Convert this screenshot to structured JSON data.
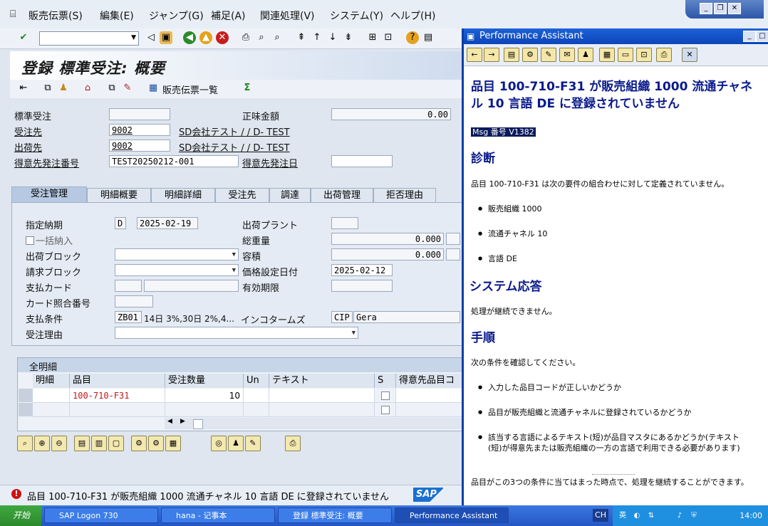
{
  "menu": [
    "販売伝票(S)",
    "編集(E)",
    "ジャンプ(G)",
    "補足(A)",
    "関連処理(V)",
    "システム(Y)",
    "ヘルプ(H)"
  ],
  "screen_title": "登録 標準受注: 概要",
  "toolbar2": {
    "list_label": "販売伝票一覧"
  },
  "header_fields": {
    "order_type_label": "標準受注",
    "net_value_label": "正味金額",
    "net_value": "0.00",
    "sold_to_label": "受注先",
    "sold_to_value": "9002",
    "sold_to_name": "SD会社テスト / / D- TEST",
    "ship_to_label": "出荷先",
    "ship_to_value": "9002",
    "ship_to_name": "SD会社テスト / / D- TEST",
    "po_number_label": "得意先発注番号",
    "po_number_value": "TEST20250212-001",
    "po_date_label": "得意先発注日"
  },
  "tabs": [
    "受注管理",
    "明細概要",
    "明細詳細",
    "受注先",
    "調達",
    "出荷管理",
    "拒否理由"
  ],
  "tab_fields": {
    "req_delivery_label": "指定納期",
    "req_delivery_type": "D",
    "req_delivery_date": "2025-02-19",
    "delivering_plant_label": "出荷プラント",
    "complete_delivery_label": "一括納入",
    "total_weight_label": "総重量",
    "total_weight": "0.000",
    "delivery_block_label": "出荷ブロック",
    "volume_label": "容積",
    "volume": "0.000",
    "billing_block_label": "請求ブロック",
    "pricing_date_label": "価格設定日付",
    "pricing_date": "2025-02-12",
    "payment_card_label": "支払カード",
    "valid_to_label": "有効期限",
    "card_verif_label": "カード照合番号",
    "payment_terms_label": "支払条件",
    "payment_terms_code": "ZB01",
    "payment_terms_text": "14日 3%,30日 2%,4...",
    "incoterms_label": "インコタームズ",
    "incoterms_code": "CIP",
    "incoterms_text": "Gera",
    "order_reason_label": "受注理由"
  },
  "items_table": {
    "title": "全明細",
    "columns": [
      "明細",
      "品目",
      "受注数量",
      "Un",
      "テキスト",
      "S",
      "得意先品目コ"
    ],
    "rows": [
      {
        "item": "",
        "material": "100-710-F31",
        "qty": "10",
        "unit": "",
        "text": ""
      },
      {
        "item": "",
        "material": "",
        "qty": "",
        "unit": "",
        "text": ""
      }
    ]
  },
  "status": {
    "message": "品目 100-710-F31 が販売組織 1000 流通チャネル 10 言語 DE に登録されていません",
    "logo": "SAP"
  },
  "performance_assistant": {
    "title": "Performance Assistant",
    "heading": "品目 100-710-F31 が販売組織 1000 流通チャネル 10 言語 DE に登録されていません",
    "msg_no": "Msg 番号 V1382",
    "diag_title": "診断",
    "diag_text": "品目 100-710-F31 は次の要件の組合わせに対して定義されていません。",
    "diag_items": [
      "販売組織 1000",
      "流通チャネル 10",
      "言語 DE"
    ],
    "sys_title": "システム応答",
    "sys_text": "処理が継続できません。",
    "proc_title": "手順",
    "proc_text": "次の条件を確認してください。",
    "proc_items": [
      "入力した品目コードが正しいかどうか",
      "品目が販売組織と流通チャネルに登録されているかどうか",
      "該当する言語によるテキスト(短)が品目マスタにあるかどうか(テキスト(短)が得意先または販売組織の一方の言語で利用できる必要があります)"
    ],
    "final_text": "品目がこの3つの条件に当てはまった時点で、処理を継続することができます。"
  },
  "taskbar": {
    "start": "开始",
    "tasks": [
      "SAP Logon 730",
      "hana - 记事本",
      "登録 標準受注: 概要",
      "Performance Assistant"
    ],
    "tray_lang": "CH",
    "tray_ime": "英",
    "clock": "14:00"
  },
  "colors": {
    "accent": "#0b45b8",
    "error": "#d01010",
    "pa_heading": "#0a1a8c",
    "material_red": "#c01818"
  }
}
